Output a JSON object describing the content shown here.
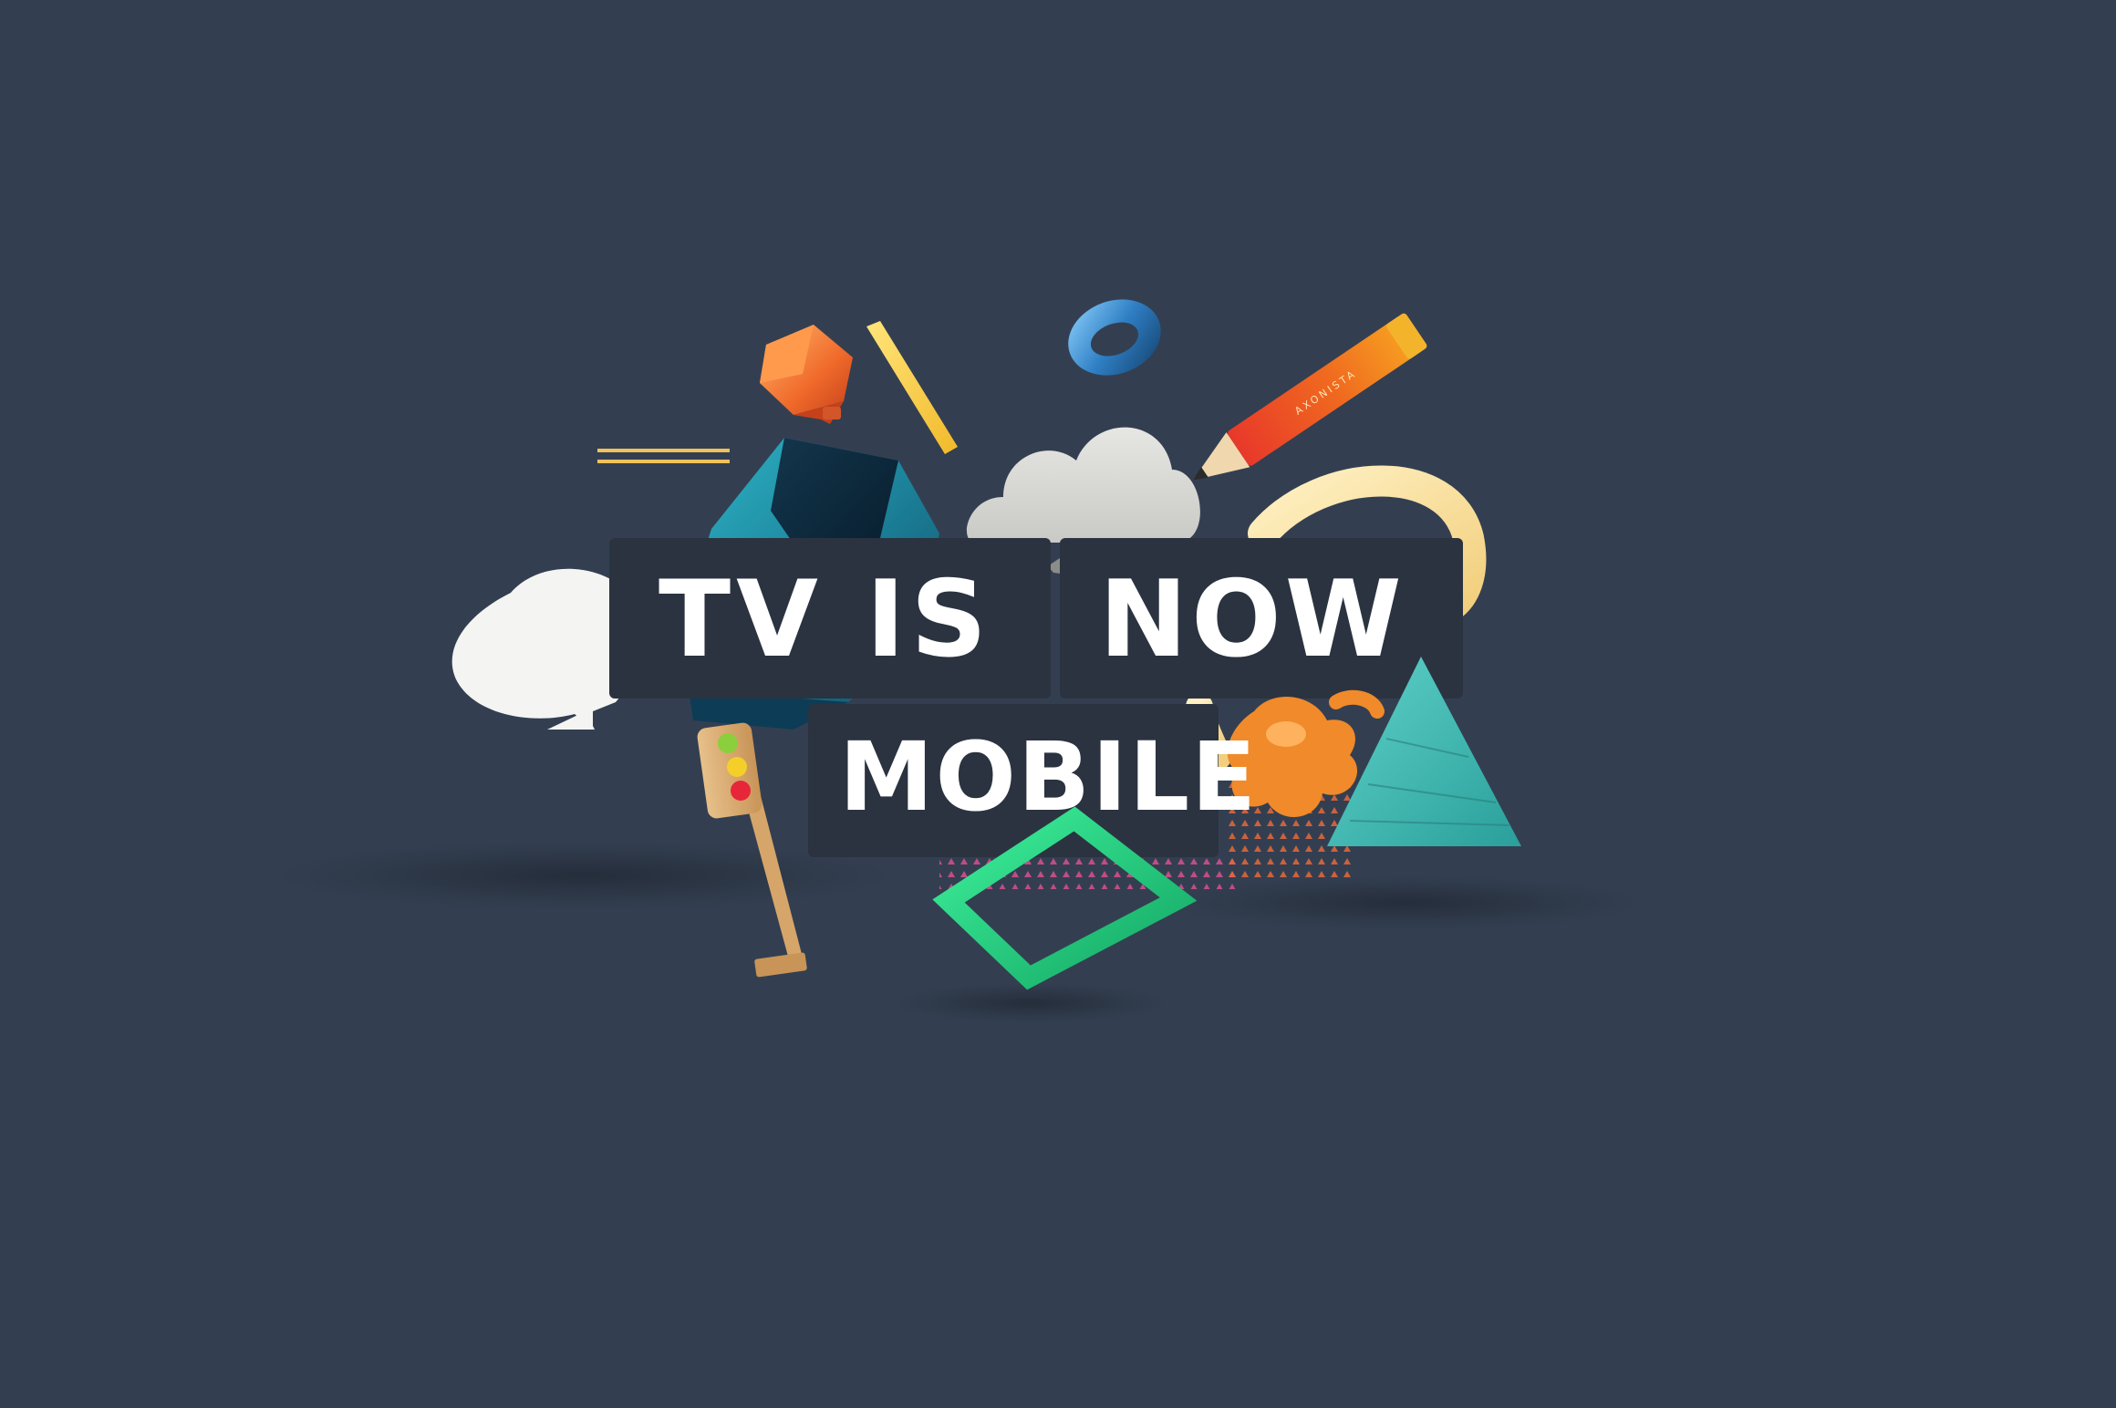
{
  "headline": {
    "line1_left": "TV IS",
    "line1_right": "NOW",
    "line2": "MOBILE"
  },
  "pencil_brand": "AXONISTA",
  "colors": {
    "background": "#333f51",
    "label_box": "#2b3340",
    "text": "#ffffff"
  }
}
